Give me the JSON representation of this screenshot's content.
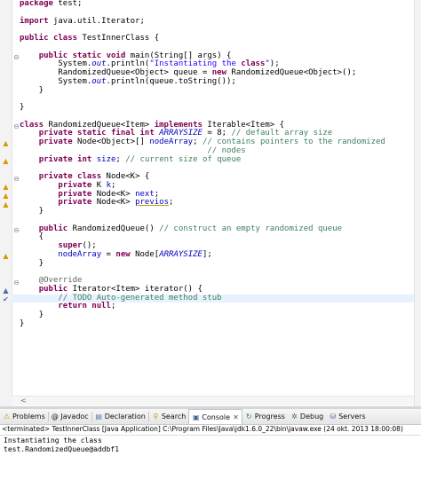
{
  "editor": {
    "lines": [
      [
        "package test;"
      ],
      [
        ""
      ],
      [
        "import java.util.Iterator;"
      ],
      [
        ""
      ],
      [
        "public class TestInnerClass {"
      ],
      [
        ""
      ],
      [
        "    public static void main(String[] args) {"
      ],
      [
        "        System.out.println(\"Instantiating the class\");"
      ],
      [
        "        RandomizedQueue<Object> queue = new RandomizedQueue<Object>();"
      ],
      [
        "        System.out.println(queue.toString());"
      ],
      [
        "    }"
      ],
      [
        ""
      ],
      [
        "}"
      ],
      [
        ""
      ],
      [
        "class RandomizedQueue<Item> implements Iterable<Item> {"
      ],
      [
        "    private static final int ARRAYSIZE = 8; // default array size"
      ],
      [
        "    private Node<Object>[] nodeArray; // contains pointers to the randomized"
      ],
      [
        "                                       // nodes"
      ],
      [
        "    private int size; // current size of queue"
      ],
      [
        ""
      ],
      [
        "    private class Node<K> {"
      ],
      [
        "        private K k;"
      ],
      [
        "        private Node<K> next;"
      ],
      [
        "        private Node<K> previos;"
      ],
      [
        "    }"
      ],
      [
        ""
      ],
      [
        "    public RandomizedQueue() // construct an empty randomized queue"
      ],
      [
        "    {"
      ],
      [
        "        super();"
      ],
      [
        "        nodeArray = new Node[ARRAYSIZE];"
      ],
      [
        "    }"
      ],
      [
        ""
      ],
      [
        "    @Override"
      ],
      [
        "    public Iterator<Item> iterator() {"
      ],
      [
        "        // TODO Auto-generated method stub"
      ],
      [
        "        return null;"
      ],
      [
        "    }"
      ],
      [
        "}"
      ]
    ]
  },
  "scroll_arrow": "<",
  "bottom_panel": {
    "tabs": [
      {
        "label": "Problems",
        "icon": "problems-icon",
        "glyph": "⚠"
      },
      {
        "label": "@ Javadoc",
        "icon": "javadoc-icon",
        "glyph": ""
      },
      {
        "label": "Declaration",
        "icon": "declaration-icon",
        "glyph": "▤"
      },
      {
        "label": "Search",
        "icon": "search-icon",
        "glyph": "🔍"
      },
      {
        "label": "Console",
        "icon": "console-icon",
        "glyph": "▣",
        "active": true
      },
      {
        "label": "Progress",
        "icon": "progress-icon",
        "glyph": "↻"
      },
      {
        "label": "Debug",
        "icon": "debug-icon",
        "glyph": "✲"
      },
      {
        "label": "Servers",
        "icon": "servers-icon",
        "glyph": "⛁"
      }
    ],
    "close_glyph": "✕",
    "console_status": "<terminated> TestInnerClass [Java Application] C:\\Program Files\\Java\\jdk1.6.0_22\\bin\\javaw.exe (24 okt. 2013 18:00:08)",
    "console_output": "Instantiating the class\ntest.RandomizedQueue@addbf1"
  },
  "colors": {
    "keyword": "#7f0055",
    "comment": "#3f7f5f",
    "string": "#2a00ff",
    "field": "#0000c0",
    "annotation": "#646464",
    "current_line": "#e8f2fe"
  }
}
